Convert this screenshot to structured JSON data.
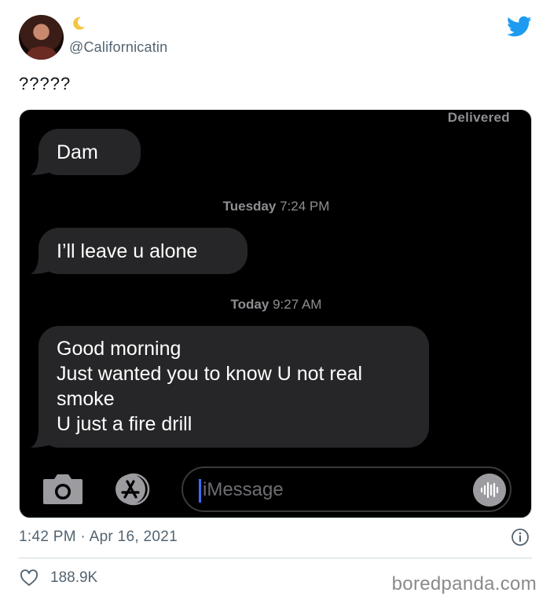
{
  "tweet": {
    "handle": "@Californicatin",
    "name_emoji": "moon-icon",
    "text": "?????",
    "timestamp": "1:42 PM · Apr 16, 2021",
    "likes": "188.9K",
    "brand_color": "#1d9bf0"
  },
  "messages_screenshot": {
    "status": "Delivered",
    "timestamps": [
      {
        "day": "Tuesday",
        "time": "7:24 PM"
      },
      {
        "day": "Today",
        "time": "9:27 AM"
      }
    ],
    "bubbles": [
      {
        "lines": [
          "Dam"
        ]
      },
      {
        "lines": [
          "I’ll leave u alone"
        ]
      },
      {
        "lines": [
          "Good morning",
          "Just wanted you to know U not real",
          "smoke",
          "U just a fire drill"
        ]
      }
    ],
    "input_placeholder": "iMessage",
    "bubble_color": "#262628"
  },
  "watermark": "boredpanda.com"
}
